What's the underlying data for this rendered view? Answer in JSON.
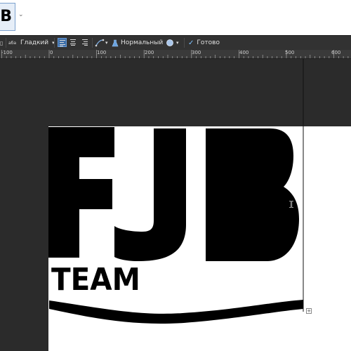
{
  "font_preview": {
    "text": "B"
  },
  "toolbar": {
    "style_icon_text": "аба",
    "smoothing_label": "Гладкий",
    "blend_label": "Нормальный",
    "done_label": "Готово"
  },
  "ruler": {
    "labels": [
      "-100",
      "0",
      "100",
      "200",
      "300",
      "400",
      "500",
      "600"
    ]
  },
  "logo": {
    "letters": "FJB",
    "subtitle": "TEAM"
  },
  "colors": {
    "canvas_bg": "#2b2b2b",
    "toolbar_bg": "#323232",
    "active_blue": "#3d6ea8",
    "ink": "#000000"
  },
  "icons": [
    "chevron-down-icon",
    "text-style-icon",
    "align-left-icon",
    "align-center-icon",
    "align-right-icon",
    "path-icon",
    "flask-icon",
    "blob-icon",
    "checkmark-icon",
    "resize-handle-icon",
    "ibeam-cursor-icon"
  ]
}
